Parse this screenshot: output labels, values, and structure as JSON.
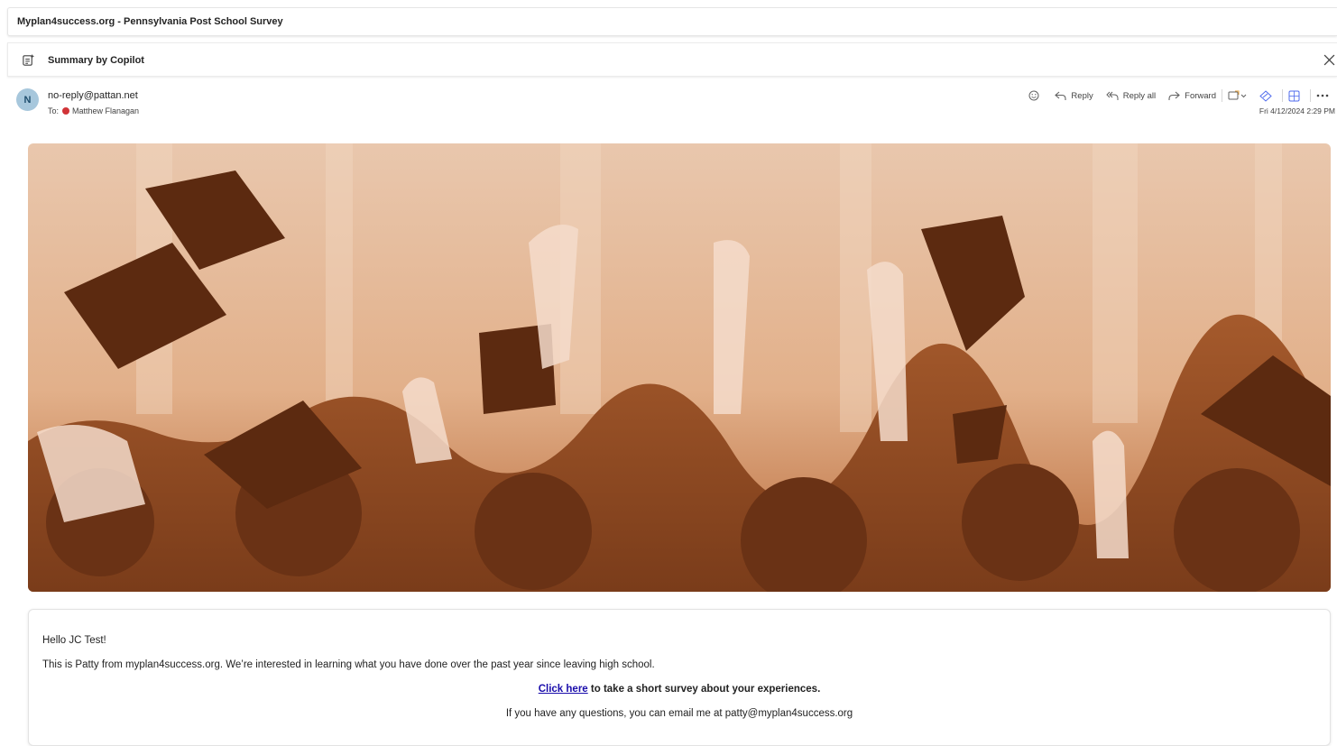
{
  "email": {
    "subject": "Myplan4success.org - Pennsylvania Post School Survey",
    "copilot_label": "Summary by Copilot",
    "sender_initial": "N",
    "sender": "no-reply@pattan.net",
    "to_label": "To:",
    "recipient": "Matthew Flanagan",
    "date": "Fri 4/12/2024 2:29 PM"
  },
  "actions": {
    "reply": "Reply",
    "reply_all": "Reply all",
    "forward": "Forward"
  },
  "body": {
    "greeting": "Hello JC Test!",
    "intro": "This is Patty from myplan4success.org. We’re interested in learning what you have done over the past year since leaving high school.",
    "link_text": "Click here",
    "link_rest": " to take a short survey about your experiences.",
    "contact": "If you have any questions, you can email me at patty@myplan4success.org"
  },
  "colors": {
    "hero_tint": "#d38a55",
    "link": "#1a0dab",
    "presence": "#d13438"
  },
  "icons": [
    "copilot-summary-icon",
    "close-icon",
    "emoji-icon",
    "reply-icon",
    "reply-all-icon",
    "forward-icon",
    "tag-icon",
    "sticker-icon",
    "apps-icon",
    "more-icon",
    "presence-dot"
  ]
}
